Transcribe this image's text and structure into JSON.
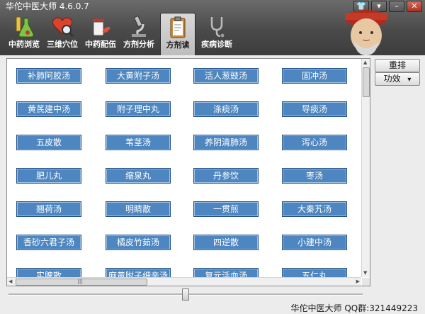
{
  "window": {
    "title": "华佗中医大师 4.6.0.7"
  },
  "tabs": [
    {
      "label": "中药浏览",
      "icon": "flask-icon"
    },
    {
      "label": "三维穴位",
      "icon": "heart-magnifier-icon"
    },
    {
      "label": "中药配伍",
      "icon": "pill-bottle-icon"
    },
    {
      "label": "方剂分析",
      "icon": "microscope-icon"
    },
    {
      "label": "方剂读",
      "icon": "clipboard-icon",
      "active": true
    },
    {
      "label": "疾病诊断",
      "icon": "stethoscope-icon"
    }
  ],
  "formulas": [
    [
      "补肺阿胶汤",
      "大黄附子汤",
      "活人葱豉汤",
      "固冲汤"
    ],
    [
      "黄芪建中汤",
      "附子理中丸",
      "涤痰汤",
      "导痰汤"
    ],
    [
      "五皮散",
      "苇茎汤",
      "养阴清肺汤",
      "泻心汤"
    ],
    [
      "肥儿丸",
      "缩泉丸",
      "丹参饮",
      "枣汤"
    ],
    [
      "翘荷汤",
      "明睛散",
      "一贯煎",
      "大秦艽汤"
    ],
    [
      "香砂六君子汤",
      "橘皮竹茹汤",
      "四逆散",
      "小建中汤"
    ],
    [
      "实脾散",
      "麻黄附子细辛汤",
      "复元活血汤",
      "五仁丸"
    ]
  ],
  "side": {
    "rearrange": "重排",
    "efficacy": "功效",
    "efficacy_arrow": "▾"
  },
  "slider": {
    "value": 0.5
  },
  "footer": {
    "text": "华佗中医大师 QQ群:321449223"
  },
  "colors": {
    "formula_button": "#4d86c0",
    "header": "#4a4a4a"
  }
}
